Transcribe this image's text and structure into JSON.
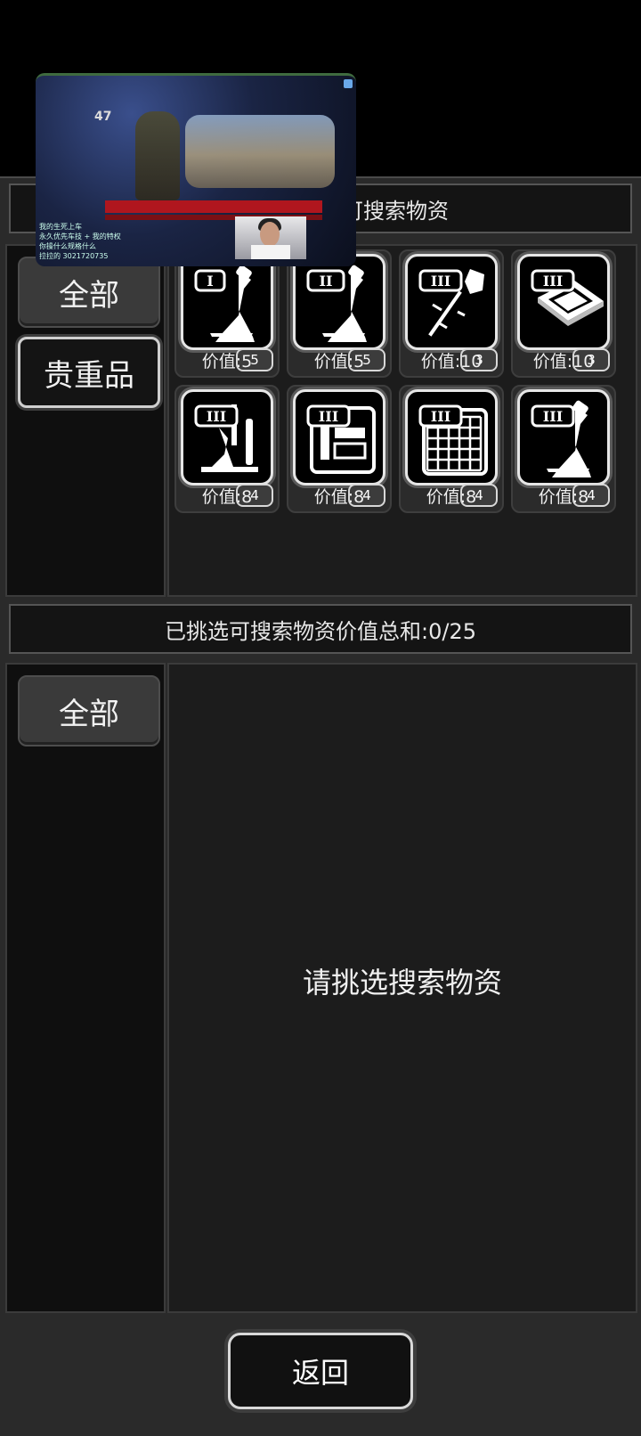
{
  "header_top": {
    "text": "可挑选的可搜索物资",
    "visible_text": "获的可搜索物资"
  },
  "categories_top": [
    {
      "label": "全部",
      "selected": false
    },
    {
      "label": "贵重品",
      "selected": true
    }
  ],
  "items": [
    {
      "icon": "flask-tier-1-icon",
      "tier": "I",
      "quantity": "5",
      "value_label": "价值:5"
    },
    {
      "icon": "flask-tier-2-icon",
      "tier": "II",
      "quantity": "5",
      "value_label": "价值:5"
    },
    {
      "icon": "scepter-tier-3-icon",
      "tier": "III",
      "quantity": "3",
      "value_label": "价值:10"
    },
    {
      "icon": "chip-tier-3-icon",
      "tier": "III",
      "quantity": "3",
      "value_label": "价值:10"
    },
    {
      "icon": "lab-equipment-tier-3-icon",
      "tier": "III",
      "quantity": "4",
      "value_label": "价值:8"
    },
    {
      "icon": "circuit-board-tier-3-icon",
      "tier": "III",
      "quantity": "4",
      "value_label": "价值:8"
    },
    {
      "icon": "grid-panel-tier-3-icon",
      "tier": "III",
      "quantity": "4",
      "value_label": "价值:8"
    },
    {
      "icon": "flask-tier-3-icon",
      "tier": "III",
      "quantity": "4",
      "value_label": "价值:8"
    }
  ],
  "header_mid": {
    "text": "已挑选可搜索物资价值总和:0/25"
  },
  "categories_bottom": [
    {
      "label": "全部",
      "selected": false
    }
  ],
  "empty_hint": "请挑选搜索物资",
  "back_button": "返回",
  "overlay": {
    "level_text": "47",
    "chat_lines": [
      "我的生死上车",
      "永久优先车技 + 我的特权",
      "你操什么规格什么",
      "拉拉的 3021720735"
    ]
  }
}
